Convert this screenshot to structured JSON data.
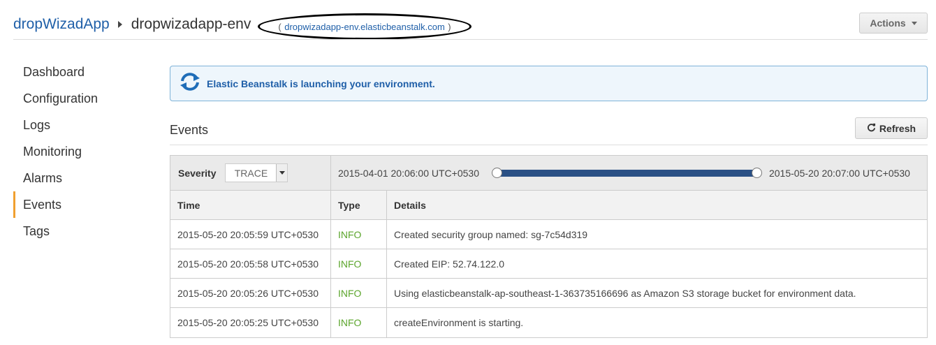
{
  "header": {
    "app_name": "dropWizadApp",
    "env_name": "dropwizadapp-env",
    "env_url": "dropwizadapp-env.elasticbeanstalk.com",
    "paren_open": "(",
    "paren_close": ")",
    "actions_label": "Actions"
  },
  "sidebar": {
    "items": [
      {
        "label": "Dashboard"
      },
      {
        "label": "Configuration"
      },
      {
        "label": "Logs"
      },
      {
        "label": "Monitoring"
      },
      {
        "label": "Alarms"
      },
      {
        "label": "Events",
        "active": true
      },
      {
        "label": "Tags"
      }
    ]
  },
  "banner": {
    "text": "Elastic Beanstalk is launching your environment.",
    "icon": "refresh-cycle-icon"
  },
  "events": {
    "title": "Events",
    "refresh_label": "Refresh",
    "filter": {
      "severity_label": "Severity",
      "severity_value": "TRACE",
      "range_start": "2015-04-01 20:06:00 UTC+0530",
      "range_end": "2015-05-20 20:07:00 UTC+0530",
      "range_selected_start_fraction": 0,
      "range_selected_end_fraction": 1
    },
    "columns": [
      "Time",
      "Type",
      "Details"
    ],
    "rows": [
      {
        "time": "2015-05-20 20:05:59 UTC+0530",
        "type": "INFO",
        "details": "Created security group named: sg-7c54d319"
      },
      {
        "time": "2015-05-20 20:05:58 UTC+0530",
        "type": "INFO",
        "details": "Created EIP: 52.74.122.0"
      },
      {
        "time": "2015-05-20 20:05:26 UTC+0530",
        "type": "INFO",
        "details": "Using elasticbeanstalk-ap-southeast-1-363735166696 as Amazon S3 storage bucket for environment data."
      },
      {
        "time": "2015-05-20 20:05:25 UTC+0530",
        "type": "INFO",
        "details": "createEnvironment is starting."
      }
    ]
  },
  "colors": {
    "link": "#1f5fa8",
    "info": "#5ba52c",
    "active_nav": "#f0a030",
    "slider": "#2a5085"
  }
}
